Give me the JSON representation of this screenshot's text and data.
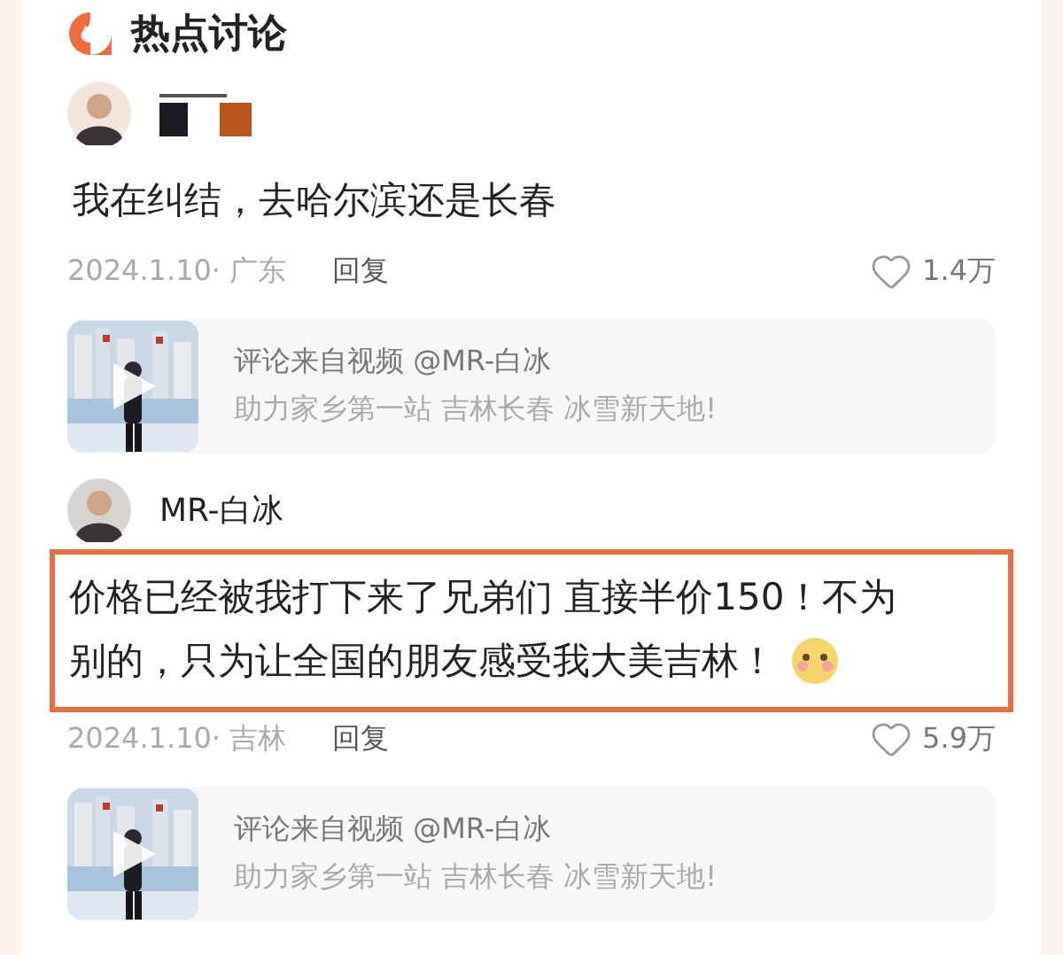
{
  "header": {
    "title": "热点讨论"
  },
  "comments": [
    {
      "kind": "redacted",
      "lines": [
        "我在纠结，去哈尔滨还是长春"
      ],
      "highlighted": false,
      "emoji": false,
      "meta": "2024.1.10· 广东",
      "reply": "回复",
      "likes": "1.4万",
      "source": {
        "label": "评论来自视频 @MR-白冰",
        "title": "助力家乡第一站 吉林长春 冰雪新天地!"
      }
    },
    {
      "kind": "named",
      "author": "MR-白冰",
      "lines": [
        "价格已经被我打下来了兄弟们 直接半价150！不为",
        "别的，只为让全国的朋友感受我大美吉林！"
      ],
      "highlighted": true,
      "emoji": true,
      "meta": "2024.1.10· 吉林",
      "reply": "回复",
      "likes": "5.9万",
      "source": {
        "label": "评论来自视频 @MR-白冰",
        "title": "助力家乡第一站 吉林长春 冰雪新天地!"
      }
    }
  ]
}
